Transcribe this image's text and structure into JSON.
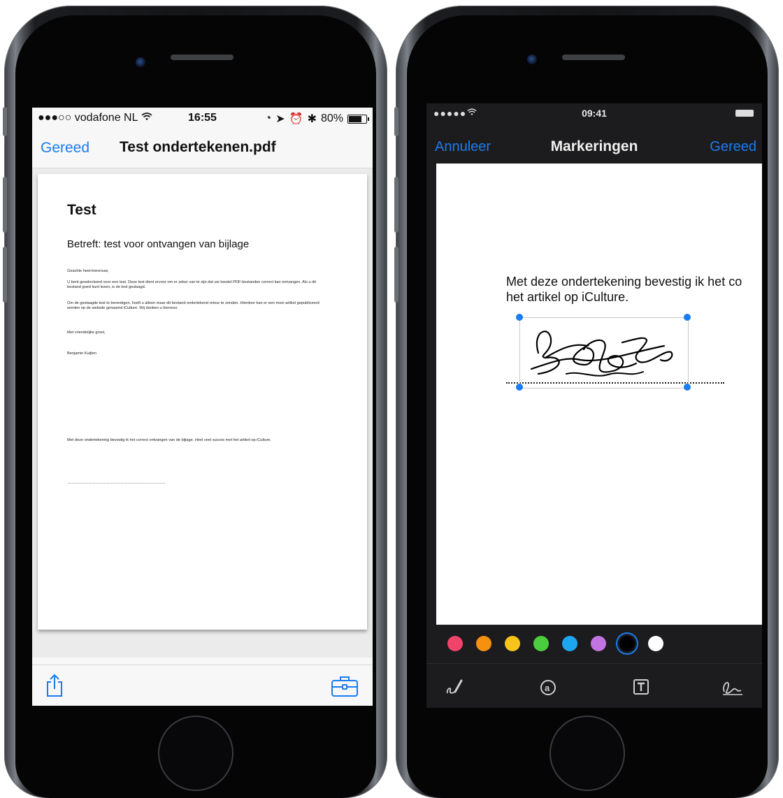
{
  "left_phone": {
    "status": {
      "carrier": "●●●○○ vodafone NL",
      "time": "16:55",
      "battery": "80%",
      "battery_level": 0.8
    },
    "nav": {
      "done": "Gereed",
      "title": "Test ondertekenen.pdf"
    },
    "document": {
      "title": "Test",
      "subject": "Betreft: test voor ontvangen van bijlage",
      "greeting": "Geachte heer/mevrouw,",
      "paragraph1": "U bent geselecteerd voor een test. Deze test dient ervoor om er zeker van te zijn dat uw toestel PDF-bestanden correct kan ontvangen. Als u dit bestand goed kunt lezen, is de test geslaagd.",
      "paragraph2": "Om de geslaagde test te bevestigen, hoeft u alleen maar dit bestand ondertekend retour te zenden. Hierdoor kan er een mooi artikel gepubliceerd worden op de website genaamd iCulture. Wij danken u hiervoor.",
      "closing": "Met vriendelijke groet,",
      "signer": "Benjamin Kuijten",
      "confirmation": "Met deze ondertekening bevestig ik het correct ontvangen van de bijlage. Heel veel succes met het artikel op iCulture."
    },
    "toolbar": {
      "share_icon": "share-icon",
      "tools_icon": "briefcase-icon"
    }
  },
  "right_phone": {
    "status": {
      "signal": "●●●●● ",
      "time": "09:41"
    },
    "nav": {
      "cancel": "Annuleer",
      "title": "Markeringen",
      "done": "Gereed"
    },
    "canvas": {
      "text_line1": "Met deze ondertekening bevestig ik het co",
      "text_line2": "het artikel op iCulture."
    },
    "palette": [
      {
        "name": "red",
        "color": "#f2446b"
      },
      {
        "name": "orange",
        "color": "#f6900f"
      },
      {
        "name": "yellow",
        "color": "#f7c51a"
      },
      {
        "name": "green",
        "color": "#4ccd3f"
      },
      {
        "name": "blue",
        "color": "#1da6f0"
      },
      {
        "name": "purple",
        "color": "#c274e0"
      },
      {
        "name": "black",
        "color": "#000000",
        "selected": true
      },
      {
        "name": "white",
        "color": "#ffffff"
      }
    ],
    "tools": [
      "sketch-icon",
      "magnifier-icon",
      "text-icon",
      "signature-icon"
    ]
  },
  "accent_color": "#1a7cf0"
}
